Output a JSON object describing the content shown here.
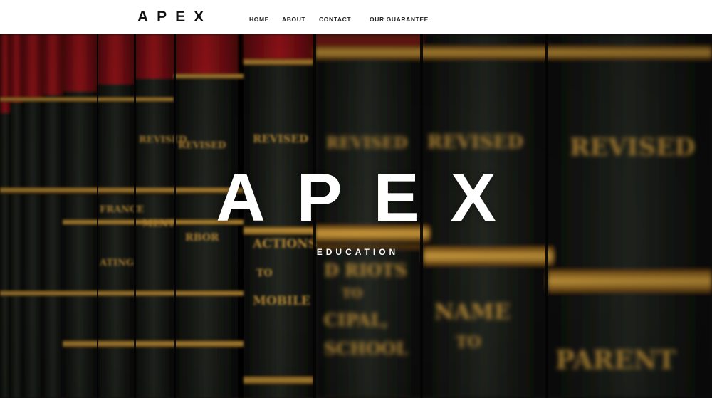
{
  "header": {
    "brand": "APEX",
    "nav": [
      {
        "label": "HOME"
      },
      {
        "label": "ABOUT"
      },
      {
        "label": "CONTACT"
      },
      {
        "label": "OUR GUARANTEE"
      }
    ]
  },
  "hero": {
    "title": "APEX",
    "subtitle": "EDUCATION",
    "background": "law-books-photo",
    "spine_labels": [
      "REVISED",
      "REVISED",
      "REVISED",
      "REVISED",
      "REVISED",
      "REVISED",
      "RIOTS",
      "SCHOOL",
      "MOBILE",
      "ACTIONS",
      "NAME",
      "PARENT"
    ]
  },
  "colors": {
    "header_bg": "#ffffff",
    "brand": "#111111",
    "hero_text": "#ffffff",
    "spine_red": "#a0121a",
    "spine_dark": "#1b1f1a",
    "gold": "#c8962e"
  }
}
